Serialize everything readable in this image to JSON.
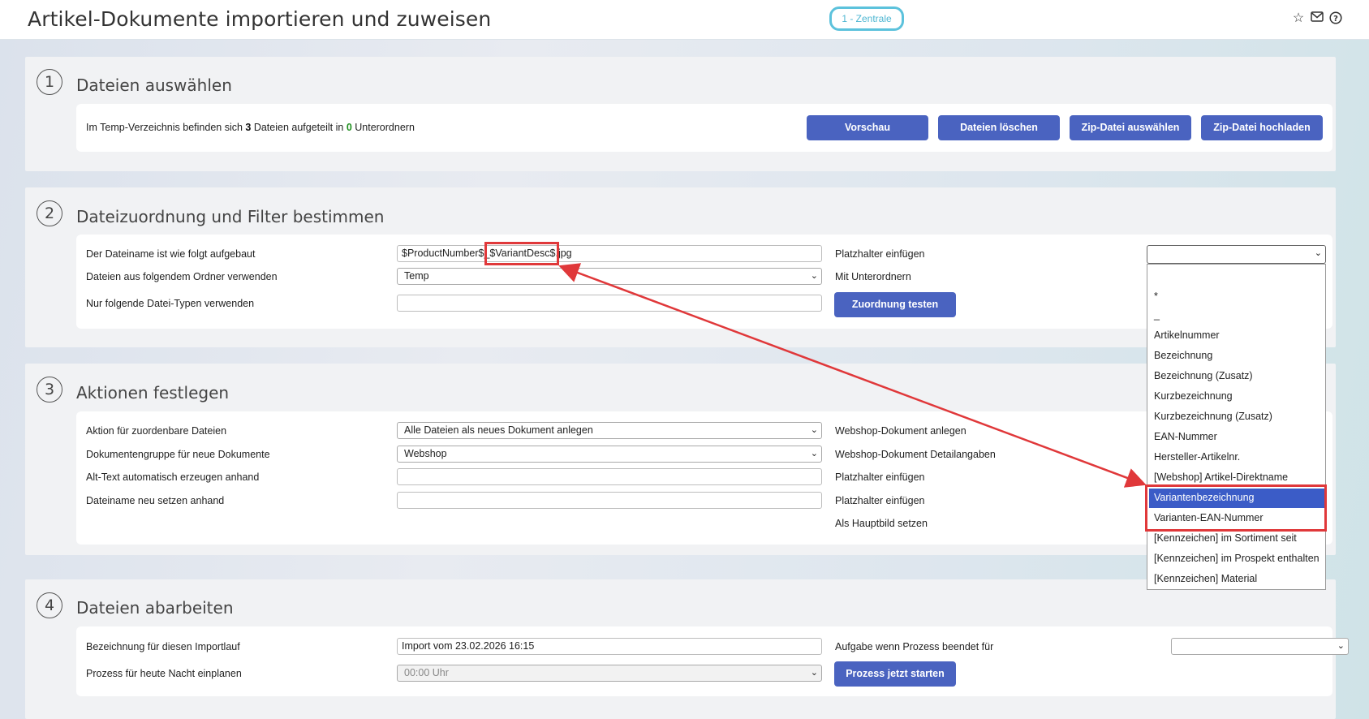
{
  "header": {
    "title": "Artikel-Dokumente importieren und zuweisen",
    "branch": "1 - Zentrale",
    "icons": [
      "star-icon",
      "mail-icon",
      "help-icon"
    ]
  },
  "section1": {
    "number": "1",
    "title": "Dateien auswählen",
    "info_prefix": "Im Temp-Verzeichnis befinden sich ",
    "file_count": "3",
    "info_middle": " Dateien aufgeteilt in ",
    "folder_count": "0",
    "info_suffix": " Unterordnern",
    "buttons": {
      "preview": "Vorschau",
      "delete": "Dateien löschen",
      "choose_zip": "Zip-Datei auswählen",
      "upload_zip": "Zip-Datei hochladen"
    }
  },
  "section2": {
    "number": "2",
    "title": "Dateizuordnung und Filter bestimmen",
    "filename_label": "Der Dateiname ist wie folgt aufgebaut",
    "filename_value_a": "$ProductNumber$",
    "filename_value_b": "_$VariantDesc$",
    "filename_value_c": ".jpg",
    "folder_label": "Dateien aus folgendem Ordner verwenden",
    "folder_value": "Temp",
    "types_label": "Nur folgende Datei-Typen verwenden",
    "types_value": "",
    "placeholder_label": "Platzhalter einfügen",
    "subfolders_label": "Mit Unterordnern",
    "test_button": "Zuordnung testen"
  },
  "section3": {
    "number": "3",
    "title": "Aktionen festlegen",
    "action_label": "Aktion für zuordenbare Dateien",
    "action_value": "Alle Dateien als neues Dokument anlegen",
    "group_label": "Dokumentengruppe für neue Dokumente",
    "group_value": "Webshop",
    "alt_label": "Alt-Text automatisch erzeugen anhand",
    "alt_value": "",
    "rename_label": "Dateiname neu setzen anhand",
    "rename_value": "",
    "right_labels": [
      "Webshop-Dokument anlegen",
      "Webshop-Dokument Detailangaben",
      "Platzhalter einfügen",
      "Platzhalter einfügen",
      "Als Hauptbild setzen"
    ]
  },
  "section4": {
    "number": "4",
    "title": "Dateien abarbeiten",
    "name_label": "Bezeichnung für diesen Importlauf",
    "name_value": "Import vom 23.02.2026 16:15",
    "schedule_label": "Prozess für heute Nacht einplanen",
    "schedule_value": "00:00 Uhr",
    "task_label": "Aufgabe wenn Prozess beendet für",
    "start_button": "Prozess jetzt starten"
  },
  "dropdown": {
    "selected": "Variantenbezeichnung",
    "items": [
      "*",
      "_",
      "Artikelnummer",
      "Bezeichnung",
      "Bezeichnung (Zusatz)",
      "Kurzbezeichnung",
      "Kurzbezeichnung (Zusatz)",
      "EAN-Nummer",
      "Hersteller-Artikelnr.",
      "[Webshop] Artikel-Direktname",
      "Variantenbezeichnung",
      "Varianten-EAN-Nummer",
      "[Kennzeichen] im Sortiment seit",
      "[Kennzeichen] im Prospekt enthalten",
      "[Kennzeichen] Material"
    ]
  },
  "colors": {
    "accent_button": "#4a63c0",
    "highlight_red": "#e0383a",
    "selection_blue": "#3b5cc7",
    "branch_border": "#5cc2dc"
  }
}
